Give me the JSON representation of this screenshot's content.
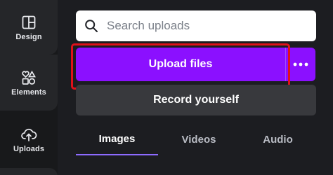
{
  "sidebar": {
    "items": [
      {
        "label": "Design",
        "icon": "design-layout-icon"
      },
      {
        "label": "Elements",
        "icon": "shapes-icon"
      },
      {
        "label": "Uploads",
        "icon": "cloud-upload-icon",
        "active": true
      }
    ]
  },
  "search": {
    "placeholder": "Search uploads"
  },
  "upload": {
    "primary_label": "Upload files",
    "more_icon": "ellipsis-icon"
  },
  "record": {
    "label": "Record yourself"
  },
  "tabs": [
    {
      "label": "Images",
      "active": true
    },
    {
      "label": "Videos"
    },
    {
      "label": "Audio"
    }
  ],
  "colors": {
    "accent": "#8b10ff",
    "highlight": "#e0111b",
    "tab_underline": "#8d6bff"
  }
}
